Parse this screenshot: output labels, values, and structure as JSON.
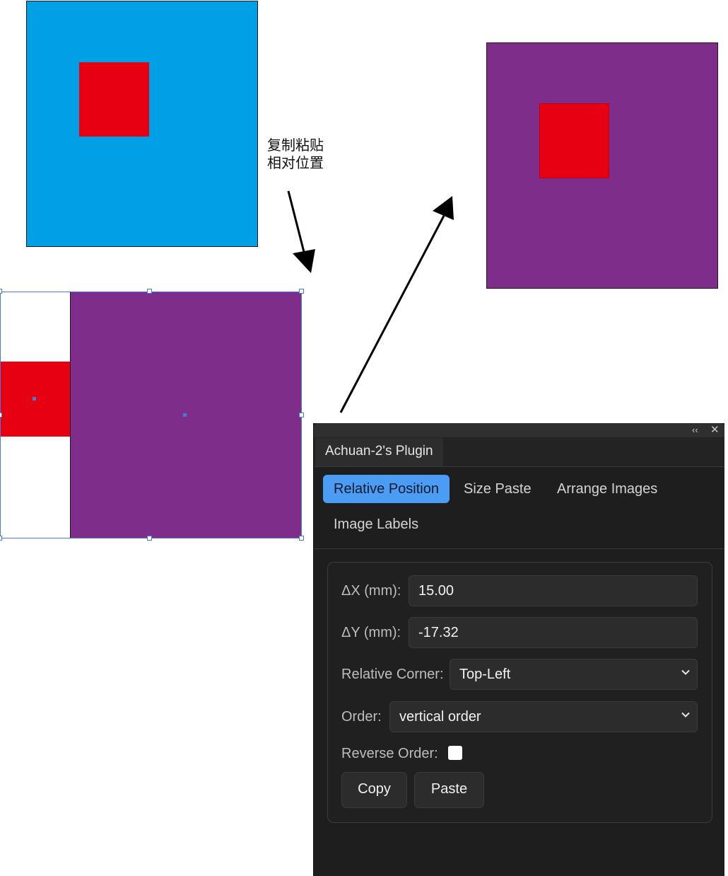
{
  "canvas": {
    "note_lines": [
      "复制粘贴",
      "相对位置"
    ],
    "colors": {
      "blue": "#00a0e6",
      "red": "#e60012",
      "purple": "#7f2d8b",
      "selection": "#4a78d8"
    }
  },
  "panel": {
    "icons": {
      "collapse": "collapse-icon",
      "close": "close-icon"
    },
    "title_tab": "Achuan-2's Plugin",
    "tabs": [
      {
        "label": "Relative Position",
        "active": true
      },
      {
        "label": "Size Paste",
        "active": false
      },
      {
        "label": "Arrange Images",
        "active": false
      },
      {
        "label": "Image Labels",
        "active": false
      }
    ],
    "form": {
      "dx_label": "ΔX (mm):",
      "dx_value": "15.00",
      "dy_label": "ΔY (mm):",
      "dy_value": "-17.32",
      "corner_label": "Relative Corner:",
      "corner_value": "Top-Left",
      "order_label": "Order:",
      "order_value": "vertical order",
      "reverse_label": "Reverse Order:",
      "reverse_checked": false,
      "copy_label": "Copy",
      "paste_label": "Paste"
    },
    "accent_color": "#4b9cf5"
  }
}
